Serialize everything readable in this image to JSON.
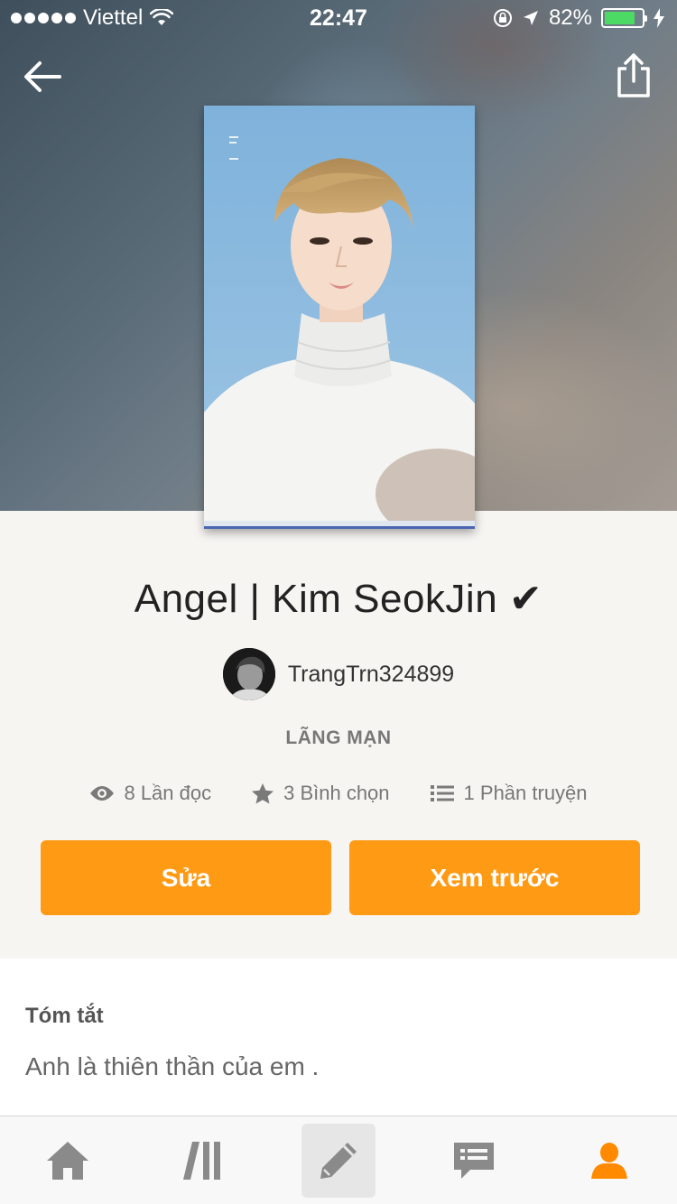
{
  "status_bar": {
    "carrier": "Viettel",
    "time": "22:47",
    "battery": "82%",
    "battery_level": 0.82
  },
  "story": {
    "title": "Angel | Kim SeokJin ✔",
    "author": "TrangTrn324899",
    "genre": "LÃNG MẠN",
    "stats": {
      "reads": "8 Lần đọc",
      "votes": "3 Bình chọn",
      "parts": "1 Phần truyện"
    }
  },
  "actions": {
    "edit_label": "Sửa",
    "preview_label": "Xem trước"
  },
  "summary": {
    "heading": "Tóm tắt",
    "text": "Anh là thiên thần của em ."
  },
  "tabbar": {
    "items": [
      "home-icon",
      "library-icon",
      "write-icon",
      "messages-icon",
      "profile-icon"
    ],
    "active": "write-icon"
  },
  "colors": {
    "accent": "#ff9a14",
    "battery": "#4cd964",
    "active_tab": "#ff8a00"
  }
}
